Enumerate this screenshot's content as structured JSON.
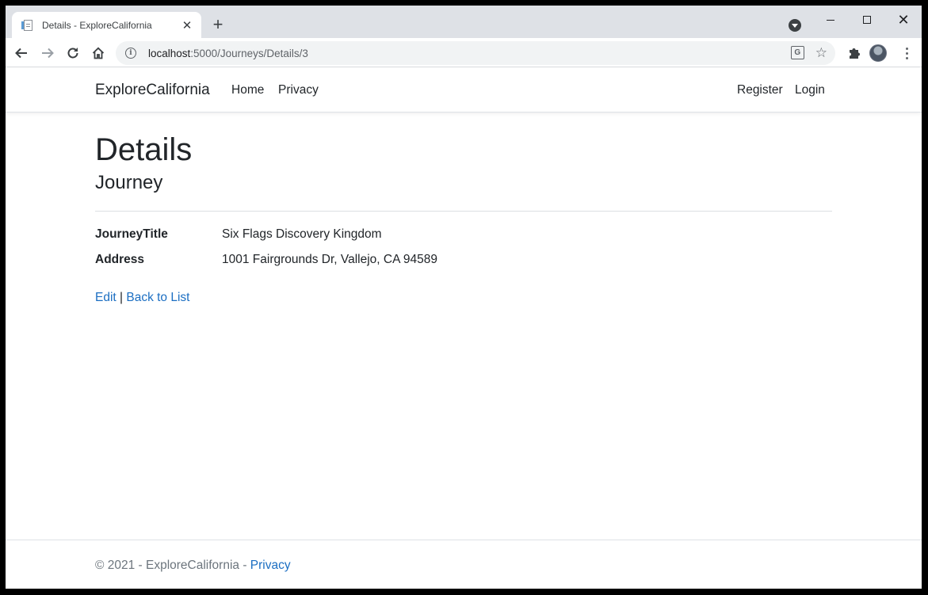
{
  "browser": {
    "tab_title": "Details - ExploreCalifornia",
    "tab_close": "✕",
    "new_tab": "+",
    "url_host": "localhost",
    "url_path": ":5000/Journeys/Details/3",
    "win_close": "✕"
  },
  "nav": {
    "brand": "ExploreCalifornia",
    "home": "Home",
    "privacy": "Privacy",
    "register": "Register",
    "login": "Login"
  },
  "main": {
    "heading": "Details",
    "subheading": "Journey",
    "fields": [
      {
        "label": "JourneyTitle",
        "value": "Six Flags Discovery Kingdom"
      },
      {
        "label": "Address",
        "value": "1001 Fairgrounds Dr, Vallejo, CA 94589"
      }
    ],
    "edit_link": "Edit",
    "separator": " | ",
    "back_link": "Back to List"
  },
  "footer": {
    "text": "© 2021 - ExploreCalifornia - ",
    "privacy": "Privacy"
  },
  "colors": {
    "link": "#1b6ec2",
    "text": "#212529",
    "muted": "#6c757d",
    "tabstrip": "#dee1e6"
  },
  "icons": [
    "page-favicon-icon",
    "close-icon",
    "plus-icon",
    "chevron-down-icon",
    "minimize-icon",
    "maximize-icon",
    "back-arrow-icon",
    "forward-arrow-icon",
    "reload-icon",
    "home-icon",
    "info-icon",
    "translate-icon",
    "star-icon",
    "puzzle-icon",
    "avatar-icon",
    "kebab-menu-icon"
  ]
}
